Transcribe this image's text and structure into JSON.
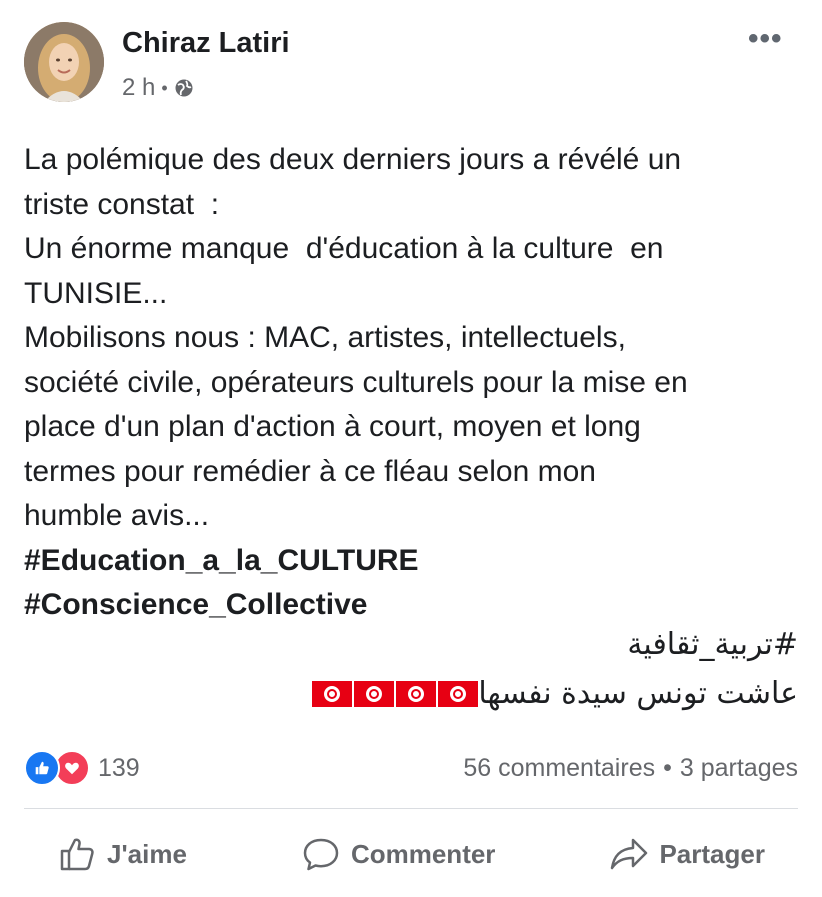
{
  "header": {
    "author": "Chiraz Latiri",
    "time": "2 h",
    "separator": "•",
    "more_label": "•••"
  },
  "post": {
    "body": "La polémique des deux derniers jours a révélé un\ntriste constat  :\nUn énorme manque  d'éducation à la culture  en\nTUNISIE...\nMobilisons nous : MAC, artistes, intellectuels,\nsociété civile, opérateurs culturels pour la mise en\nplace d'un plan d'action à court, moyen et long\ntermes pour remédier à ce fléau selon mon\nhumble avis...",
    "hashtags": [
      "#Education_a_la_CULTURE",
      "#Conscience_Collective"
    ],
    "arabic_hashtag": "#تربية_ثقافية",
    "arabic_line": "عاشت تونس سيدة نفسها",
    "flags_count": 4
  },
  "stats": {
    "reaction_count": "139",
    "comments": "56 commentaires",
    "separator": "•",
    "shares": "3 partages"
  },
  "actions": {
    "like": "J'aime",
    "comment": "Commenter",
    "share": "Partager"
  },
  "colors": {
    "like_blue": "#1877f2",
    "love_red": "#f33e58",
    "secondary_text": "#65676b",
    "tunisia_red": "#e70013"
  }
}
